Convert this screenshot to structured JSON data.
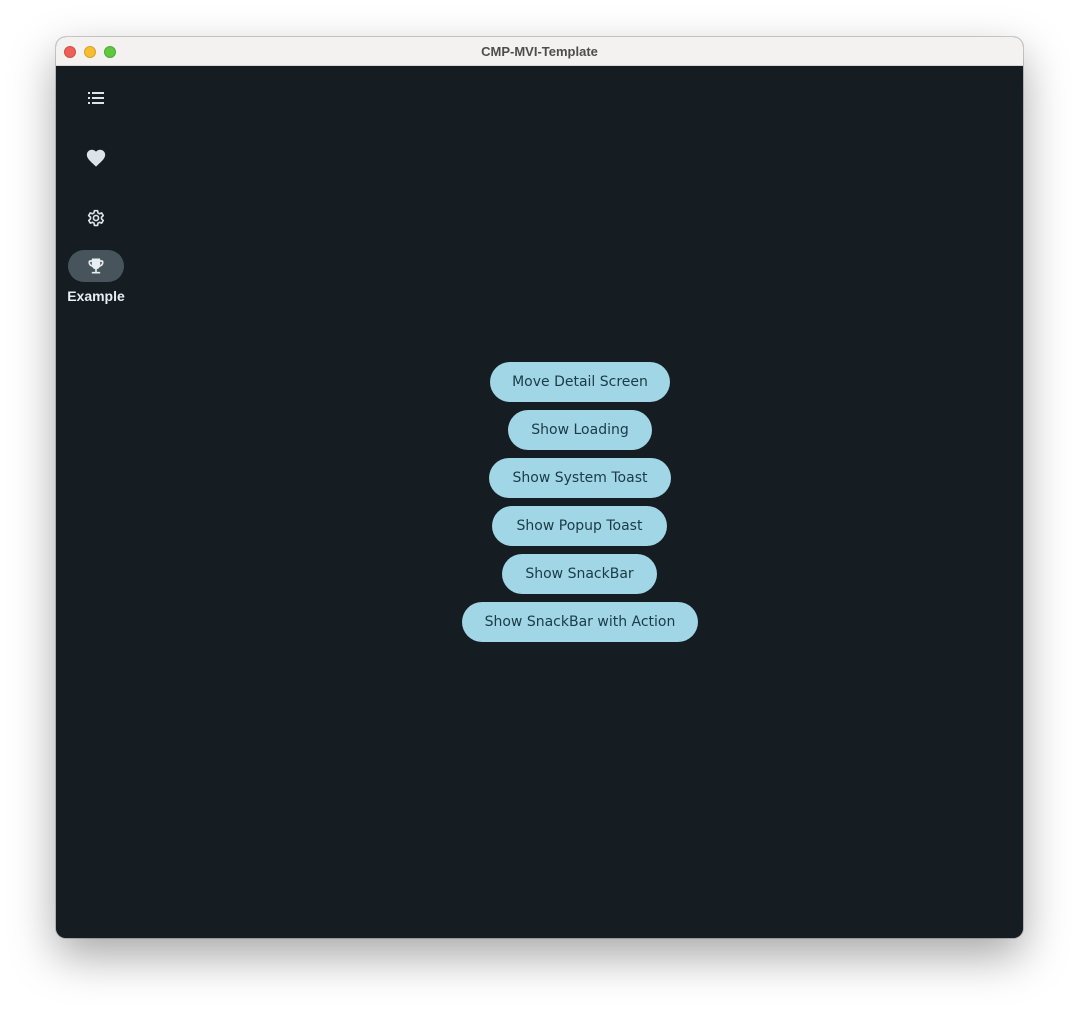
{
  "window": {
    "title": "CMP-MVI-Template"
  },
  "nav_rail": {
    "items": [
      {
        "icon": "list-icon",
        "label": "",
        "selected": false
      },
      {
        "icon": "heart-icon",
        "label": "",
        "selected": false
      },
      {
        "icon": "gear-icon",
        "label": "",
        "selected": false
      },
      {
        "icon": "trophy-icon",
        "label": "Example",
        "selected": true
      }
    ]
  },
  "main": {
    "buttons": [
      {
        "label": "Move Detail Screen"
      },
      {
        "label": "Show Loading"
      },
      {
        "label": "Show System Toast"
      },
      {
        "label": "Show Popup Toast"
      },
      {
        "label": "Show SnackBar"
      },
      {
        "label": "Show SnackBar with Action"
      }
    ]
  },
  "colors": {
    "background": "#151c22",
    "button_fill": "#a0d6e6",
    "button_text": "#1b3b46",
    "rail_selected": "#47545c",
    "icon": "#dde3e7"
  }
}
